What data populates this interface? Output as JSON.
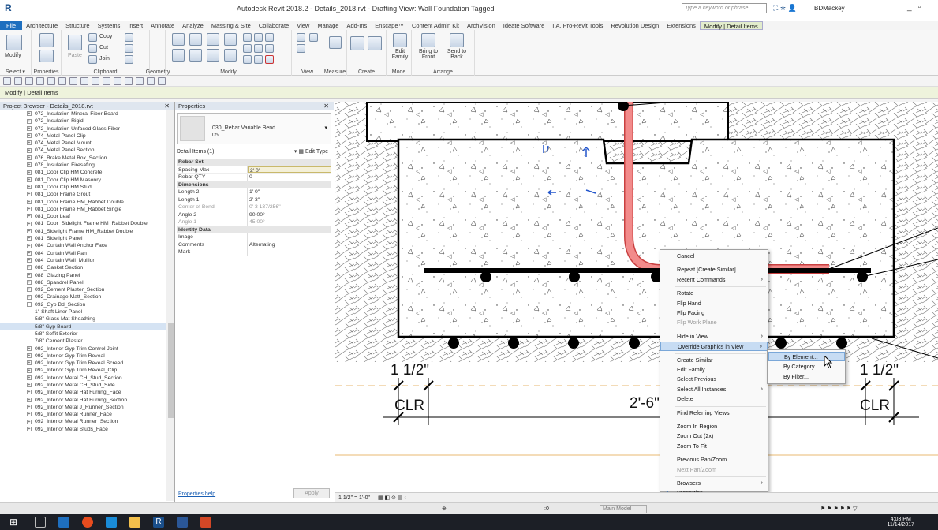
{
  "titlebar": {
    "title": "Autodesk Revit 2018.2 - Details_2018.rvt - Drafting View: Wall Foundation Tagged",
    "search_placeholder": "Type a keyword or phrase",
    "user": "BDMackey",
    "icons": [
      "binoculars-icon",
      "star-icon",
      "user-icon",
      "cart-icon",
      "help-icon"
    ],
    "window_controls": [
      "minimize",
      "maximize"
    ]
  },
  "ribbon": {
    "tabs": [
      "File",
      "Architecture",
      "Structure",
      "Systems",
      "Insert",
      "Annotate",
      "Analyze",
      "Massing & Site",
      "Collaborate",
      "View",
      "Manage",
      "Add-Ins",
      "Enscape™",
      "Content Admin Kit",
      "ArchVision",
      "Ideate Software",
      "I.A. Pro-Revit Tools",
      "Revolution Design",
      "Extensions",
      "Modify | Detail Items"
    ],
    "active_tab": "Modify | Detail Items",
    "groups": {
      "select": "Select ▾",
      "properties": "Properties",
      "clipboard": "Clipboard",
      "geometry": "Geometry",
      "modify": "Modify",
      "view": "View",
      "measure": "Measure",
      "create": "Create",
      "mode": "Mode",
      "arrange": "Arrange"
    },
    "buttons": {
      "modify": "Modify",
      "paste": "Paste",
      "copy": "Copy",
      "cut": "Cut",
      "join": "Join",
      "edit_family": "Edit Family",
      "bring_to_front": "Bring to Front",
      "send_to_back": "Send to Back"
    }
  },
  "context_bar": "Modify | Detail Items",
  "project_browser": {
    "title": "Project Browser - Details_2018.rvt",
    "items": [
      {
        "label": "072_Insulation Mineral Fiber Board",
        "level": 1
      },
      {
        "label": "072_Insulation Rigid",
        "level": 1
      },
      {
        "label": "072_Insulation Unfaced Glass Fiber",
        "level": 1
      },
      {
        "label": "074_Metal Panel Clip",
        "level": 1
      },
      {
        "label": "074_Metal Panel Mount",
        "level": 1
      },
      {
        "label": "074_Metal Panel Section",
        "level": 1
      },
      {
        "label": "076_Brake Metal Box_Section",
        "level": 1
      },
      {
        "label": "078_Insulation Firesafing",
        "level": 1
      },
      {
        "label": "081_Door Clip HM Concrete",
        "level": 1
      },
      {
        "label": "081_Door Clip HM Masonry",
        "level": 1
      },
      {
        "label": "081_Door Clip HM Stud",
        "level": 1
      },
      {
        "label": "081_Door Frame Grout",
        "level": 1
      },
      {
        "label": "081_Door Frame HM_Rabbet Double",
        "level": 1
      },
      {
        "label": "081_Door Frame HM_Rabbet Single",
        "level": 1
      },
      {
        "label": "081_Door Leaf",
        "level": 1
      },
      {
        "label": "081_Door_Sidelight Frame HM_Rabbet Double",
        "level": 1
      },
      {
        "label": "081_Sidelight Frame HM_Rabbet Double",
        "level": 1
      },
      {
        "label": "081_Sidelight Panel",
        "level": 1
      },
      {
        "label": "084_Curtain Wall Anchor Face",
        "level": 1
      },
      {
        "label": "084_Curtain Wall Pan",
        "level": 1
      },
      {
        "label": "084_Curtain Wall_Mullion",
        "level": 1
      },
      {
        "label": "088_Gasket Section",
        "level": 1
      },
      {
        "label": "088_Glazing Panel",
        "level": 1
      },
      {
        "label": "088_Spandrel Panel",
        "level": 1
      },
      {
        "label": "092_Cement Plaster_Section",
        "level": 1
      },
      {
        "label": "092_Drainage Matt_Section",
        "level": 1
      },
      {
        "label": "092_Gyp Bd_Section",
        "level": 1,
        "expanded": true
      },
      {
        "label": "1\" Shaft Liner Panel",
        "level": 2
      },
      {
        "label": "5/8\" Glass Mat Sheathing",
        "level": 2
      },
      {
        "label": "5/8\" Gyp Board",
        "level": 2,
        "selected": true
      },
      {
        "label": "5/8\" Soffit Exterior",
        "level": 2
      },
      {
        "label": "7/8\" Cement Plaster",
        "level": 2
      },
      {
        "label": "092_Interior Gyp Trim Control Joint",
        "level": 1
      },
      {
        "label": "092_Interior Gyp Trim Reveal",
        "level": 1
      },
      {
        "label": "092_Interior Gyp Trim Reveal Screed",
        "level": 1
      },
      {
        "label": "092_Interior Gyp Trim Reveal_Clip",
        "level": 1
      },
      {
        "label": "092_Interior Metal CH_Stud_Section",
        "level": 1
      },
      {
        "label": "092_Interior Metal CH_Stud_Side",
        "level": 1
      },
      {
        "label": "092_Interior Metal Hat Furring_Face",
        "level": 1
      },
      {
        "label": "092_Interior Metal Hat Furring_Section",
        "level": 1
      },
      {
        "label": "092_Interior Metal J_Runner_Section",
        "level": 1
      },
      {
        "label": "092_Interior Metal Runner_Face",
        "level": 1
      },
      {
        "label": "092_Interior Metal Runner_Section",
        "level": 1
      },
      {
        "label": "092_Interior Metal Studs_Face",
        "level": 1
      }
    ]
  },
  "properties": {
    "title": "Properties",
    "type_name": "030_Rebar Variable Bend",
    "type_sub": "05",
    "filter": "Detail Items (1)",
    "edit_type": "Edit Type",
    "rows": [
      {
        "kind": "section",
        "label": "Rebar Set"
      },
      {
        "label": "Spacing Max",
        "value": "2' 0\"",
        "highlight": true
      },
      {
        "label": "Rebar QTY",
        "value": "0"
      },
      {
        "kind": "section",
        "label": "Dimensions"
      },
      {
        "label": "Length 2",
        "value": "1' 0\""
      },
      {
        "label": "Length 1",
        "value": "2' 3\""
      },
      {
        "label": "Center of Bend",
        "value": "0' 3 137/256\"",
        "grey": true
      },
      {
        "label": "Angle 2",
        "value": "90.00°"
      },
      {
        "label": "Angle 1",
        "value": "45.00°",
        "grey": true
      },
      {
        "kind": "section",
        "label": "Identity Data"
      },
      {
        "label": "Image",
        "value": ""
      },
      {
        "label": "Comments",
        "value": "Alternating"
      },
      {
        "label": "Mark",
        "value": ""
      }
    ],
    "help": "Properties help",
    "apply": "Apply"
  },
  "drawing": {
    "dim_left": "1 1/2\"",
    "dim_right": "1 1/2\"",
    "clr_left": "CLR",
    "clr_right": "CLR",
    "dim_mid": "2'-6\""
  },
  "context_menu": {
    "items": [
      {
        "label": "Cancel"
      },
      {
        "sep": true
      },
      {
        "label": "Repeat [Create Similar]"
      },
      {
        "label": "Recent Commands",
        "sub": true
      },
      {
        "sep": true
      },
      {
        "label": "Rotate"
      },
      {
        "label": "Flip Hand"
      },
      {
        "label": "Flip Facing"
      },
      {
        "label": "Flip Work Plane",
        "disabled": true
      },
      {
        "sep": true
      },
      {
        "label": "Hide in View",
        "sub": true
      },
      {
        "label": "Override Graphics in View",
        "sub": true,
        "highlight": true
      },
      {
        "sep": true
      },
      {
        "label": "Create Similar"
      },
      {
        "label": "Edit Family"
      },
      {
        "label": "Select Previous"
      },
      {
        "label": "Select All Instances",
        "sub": true
      },
      {
        "label": "Delete"
      },
      {
        "sep": true
      },
      {
        "label": "Find Referring Views"
      },
      {
        "sep": true
      },
      {
        "label": "Zoom In Region"
      },
      {
        "label": "Zoom Out (2x)"
      },
      {
        "label": "Zoom To Fit"
      },
      {
        "sep": true
      },
      {
        "label": "Previous Pan/Zoom"
      },
      {
        "label": "Next Pan/Zoom",
        "disabled": true
      },
      {
        "sep": true
      },
      {
        "label": "Browsers",
        "sub": true
      },
      {
        "label": "Properties",
        "checked": true
      }
    ],
    "submenu": [
      "By Element...",
      "By Category...",
      "By Filter..."
    ]
  },
  "viewbar": {
    "scale": "1 1/2\" = 1'-0\""
  },
  "statusbar": {
    "model": "Main Model",
    "zero": ":0"
  },
  "taskbar": {
    "time": "4:03 PM",
    "date": "11/14/2017"
  },
  "colors": {
    "rebar_fill": "#f08080",
    "rebar_stroke": "#c94040",
    "accent": "#1e6fbf",
    "highlight": "#c7dcf3"
  }
}
